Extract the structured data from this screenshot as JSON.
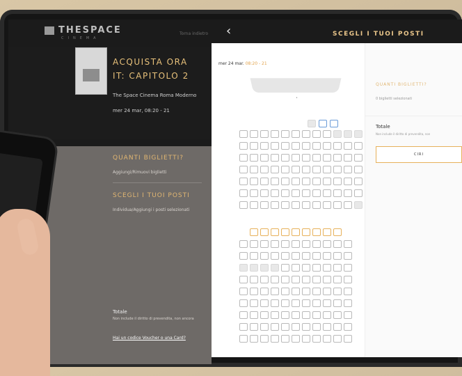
{
  "header": {
    "logo": "THESPACE",
    "logo_sub": "CINEMA",
    "back_link": "Torna indietro",
    "title": "SCEGLI I TUOI POSTI"
  },
  "movie": {
    "buy_now": "ACQUISTA ORA",
    "title": "IT: CAPITOLO 2",
    "cinema": "The Space Cinema Roma Moderno",
    "datetime": "mer 24 mar, 08:20 - 21"
  },
  "steps": {
    "tickets_title": "QUANTI BIGLIETTI?",
    "tickets_sub": "Aggiungi/Rimuovi biglietti",
    "seats_title": "SCEGLI I TUOI POSTI",
    "seats_sub": "Individua/Aggiungi i posti selezionati"
  },
  "left_total": {
    "label": "Totale",
    "note": "Non include il diritto di prevendita, non ancora",
    "voucher": "Hai un codice Voucher o una Card?"
  },
  "panel": {
    "date_prefix": "mer 24 mar.",
    "time": "08:20",
    "time_suffix": "- 21"
  },
  "sidebar": {
    "tickets_title": "QUANTI BIGLIETTI?",
    "tickets_sub": "0 biglietti selezionati",
    "total_label": "Totale",
    "total_note": "Non include il diritto di prevendita, non",
    "button_label": "CIRI"
  },
  "accent": "#e1b672"
}
